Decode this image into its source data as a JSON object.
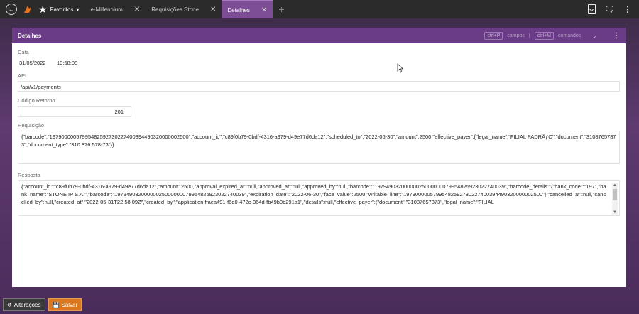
{
  "topbar": {
    "favorites_label": "Favoritos",
    "favorites_chevron": "▾",
    "tabs": [
      {
        "label": "e-Millennium",
        "close": "✕"
      },
      {
        "label": "Requisições Stone",
        "close": "✕"
      },
      {
        "label": "Detalhes",
        "close": "✕"
      }
    ],
    "add_tab": "+"
  },
  "panel": {
    "title": "Detalhes",
    "shortcut_campos_key": "ctrl+P",
    "shortcut_campos_label": "campos",
    "separator": "|",
    "shortcut_comandos_key": "ctrl+M",
    "shortcut_comandos_label": "comandos"
  },
  "fields": {
    "data_label": "Data",
    "data_date": "31/05/2022",
    "data_time": "19:58:08",
    "api_label": "API",
    "api_value": "/api/v1/payments",
    "codigo_label": "Código Retorno",
    "codigo_value": "201",
    "requisicao_label": "Requisição",
    "requisicao_value": "{\"barcode\":\"19790000057995482592730227400394490320000002500\",\"account_id\":\"c89f0b79-0bdf-4316-a979-d49e77d6da12\",\"scheduled_to\":\"2022-06-30\",\"amount\":2500,\"effective_payer\":{\"legal_name\":\"FILIAL PADRÃƒO\",\"document\":\"31087657873\",\"document_type\":\"310.876.578-73\"}}",
    "resposta_label": "Resposta",
    "resposta_value": "{\"account_id\":\"c89f0b79-0bdf-4316-a979-d49e77d6da12\",\"amount\":2500,\"approval_expired_at\":null,\"approved_at\":null,\"approved_by\":null,\"barcode\":\"19794903200000025000000079954825923022740039\",\"barcode_details\":{\"bank_code\":\"197\",\"bank_name\":\"STONE IP S.A.\",\"barcode\":\"19794903200000025000000079954825923022740039\",\"expiration_date\":\"2022-06-30\",\"face_value\":2500,\"writable_line\":\"19790000057995482592730227400394490320000002500\"},\"cancelled_at\":null,\"cancelled_by\":null,\"created_at\":\"2022-05-31T22:58:09Z\",\"created_by\":\"application:ffaea491-f6d0-472c-864d-fb49b0b291a1\",\"details\":null,\"effective_payer\":{\"document\":\"31087657873\",\"legal_name\":\"FILIAL"
  },
  "bottombar": {
    "alteracoes_label": "Alterações",
    "salvar_label": "Salvar"
  },
  "colors": {
    "accent": "#6a3b86",
    "active_tab": "#7d4e96",
    "save": "#d9781e"
  }
}
